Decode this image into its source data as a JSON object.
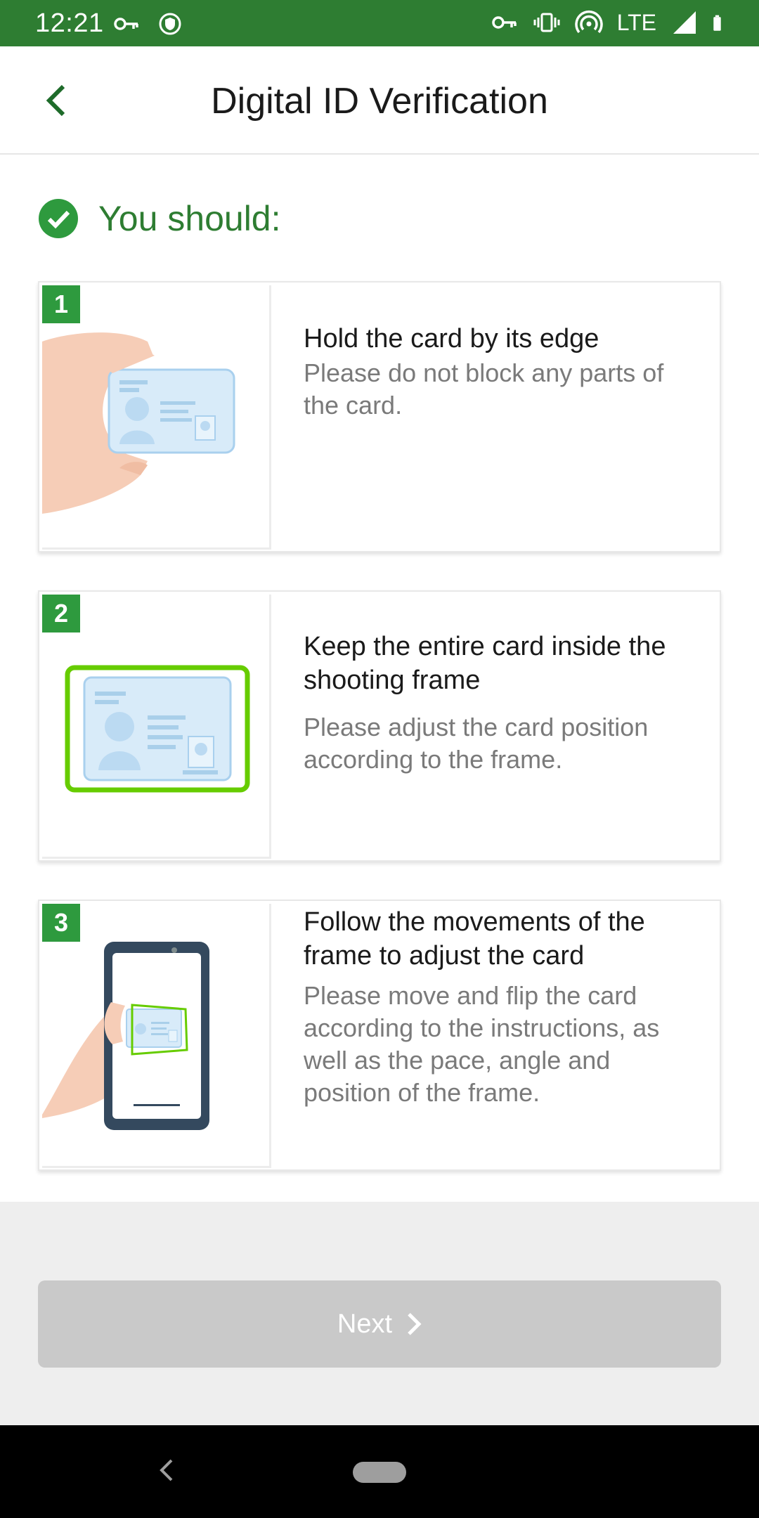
{
  "status_bar": {
    "time": "12:21",
    "network": "LTE",
    "icons": [
      "key-icon",
      "shield-icon",
      "vpn-key-icon",
      "vibrate-icon",
      "hotspot-icon",
      "signal-icon",
      "battery-icon"
    ]
  },
  "header": {
    "title": "Digital ID Verification",
    "back_icon": "chevron-left-icon"
  },
  "section": {
    "title": "You should:",
    "icon": "check-circle-icon"
  },
  "steps": [
    {
      "number": "1",
      "heading": "Hold the card by its edge",
      "description": "Please do not block any parts of the card.",
      "illustration": "hand-holding-card"
    },
    {
      "number": "2",
      "heading": "Keep the entire card inside the shooting frame",
      "description": "Please adjust the card position according to the frame.",
      "illustration": "card-in-frame"
    },
    {
      "number": "3",
      "heading": "Follow the movements of the frame to adjust the card",
      "description": "Please move and flip the card according to the instructions, as well as the pace, angle and position of the frame.",
      "illustration": "phone-scanning-card"
    }
  ],
  "footer": {
    "next_label": "Next",
    "next_icon": "chevron-right-icon"
  },
  "colors": {
    "brand_green": "#2e7d32",
    "step_badge": "#2e9a3e",
    "frame_green": "#66cc00",
    "disabled_button": "#c9c9c9"
  }
}
